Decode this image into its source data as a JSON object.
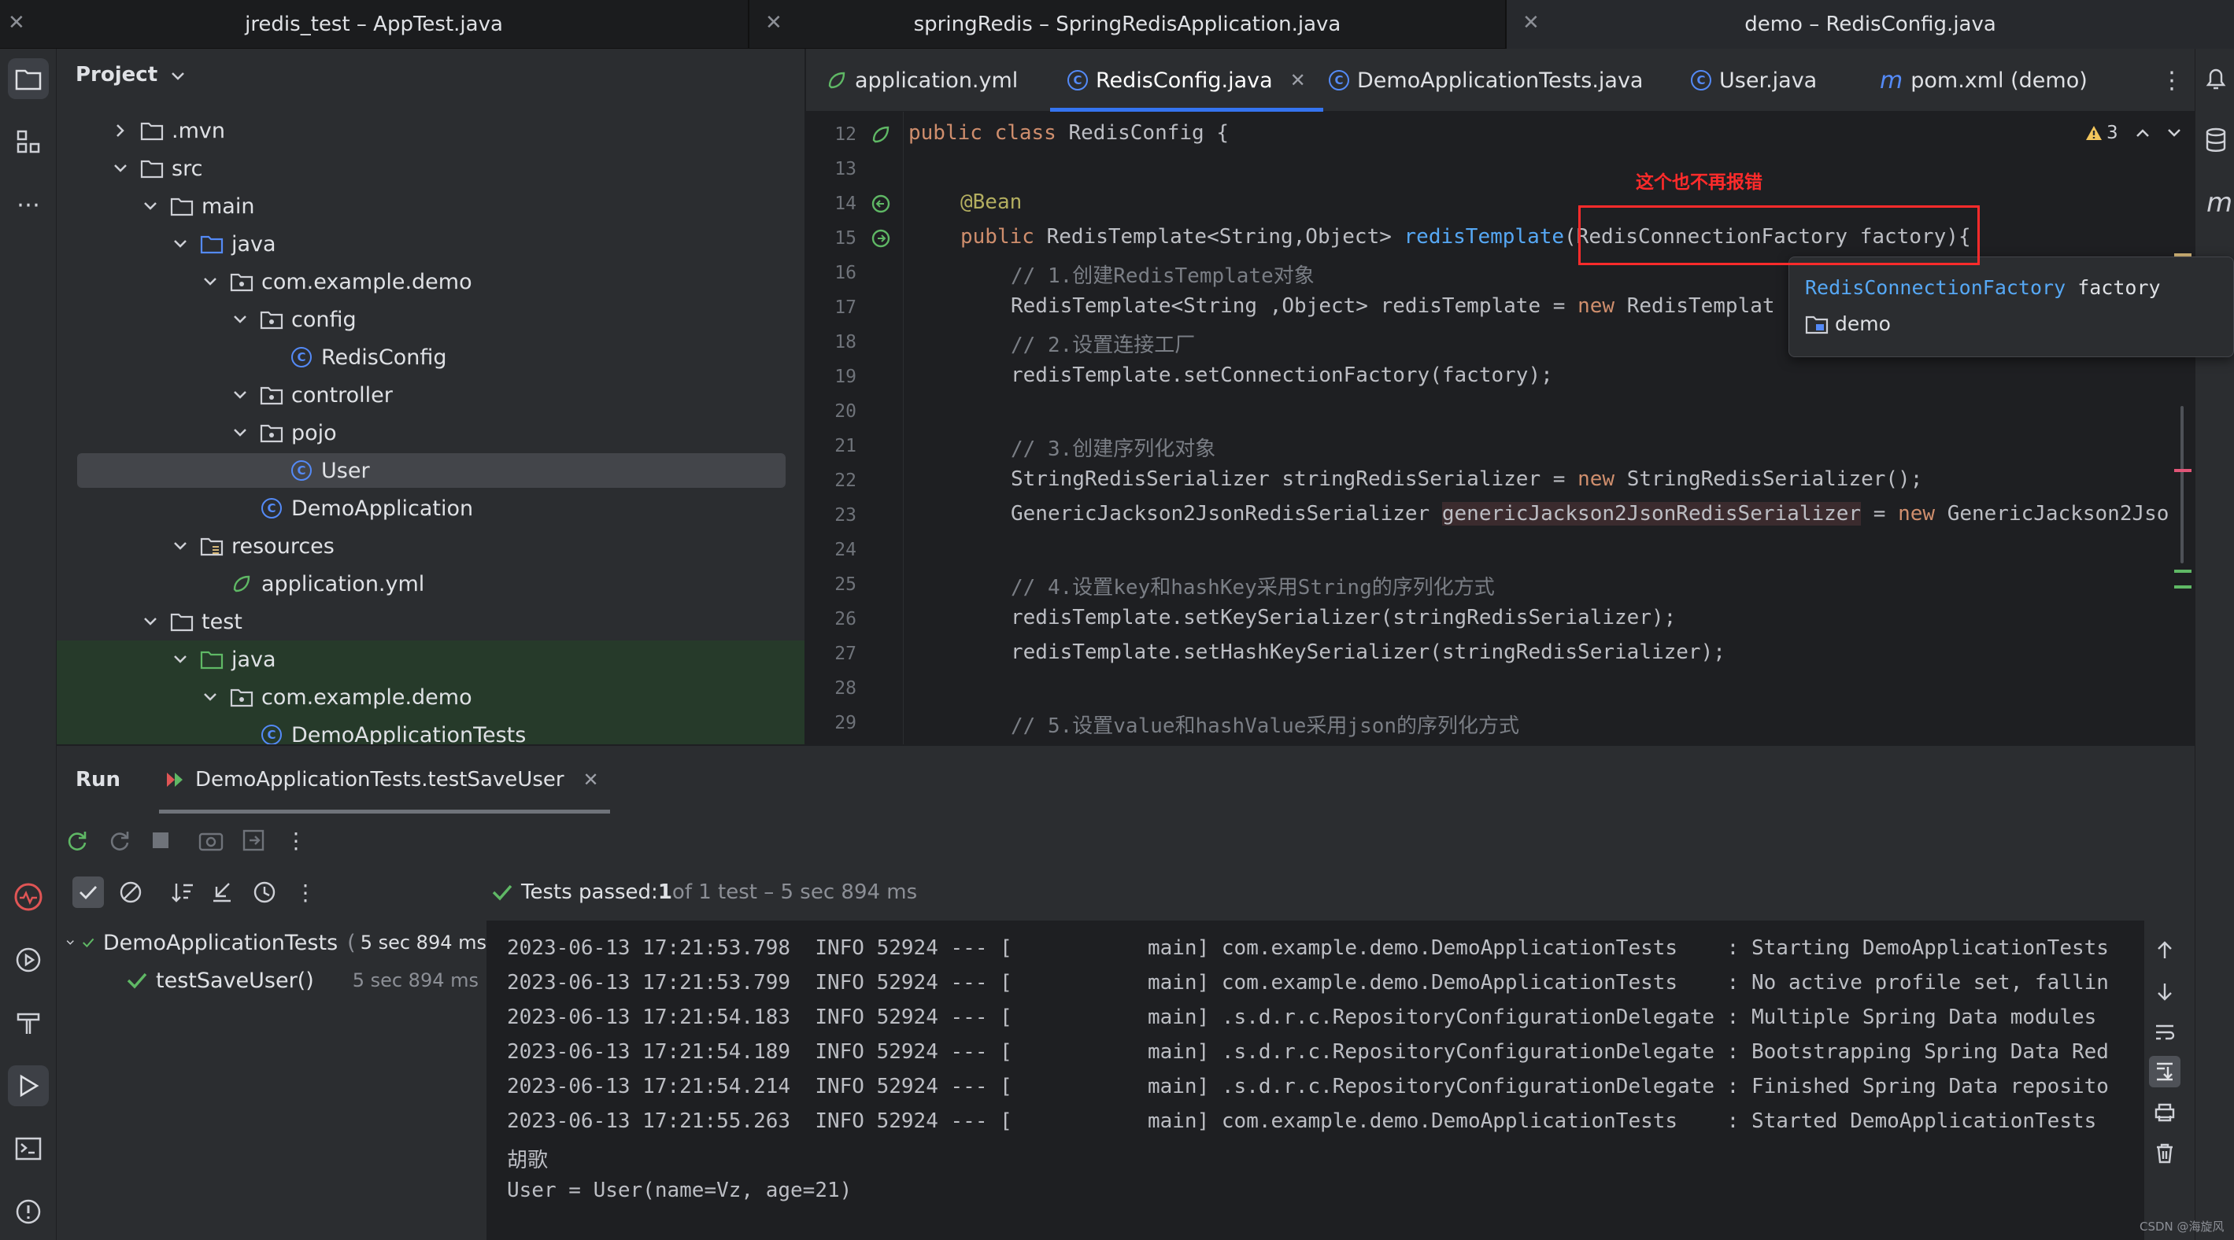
{
  "window_tabs": [
    {
      "title": "jredis_test – AppTest.java"
    },
    {
      "title": "springRedis – SpringRedisApplication.java"
    },
    {
      "title": "demo – RedisConfig.java"
    }
  ],
  "project": {
    "header": "Project",
    "tree": [
      {
        "label": ".mvn"
      },
      {
        "label": "src"
      },
      {
        "label": "main"
      },
      {
        "label": "java"
      },
      {
        "label": "com.example.demo"
      },
      {
        "label": "config"
      },
      {
        "label": "RedisConfig"
      },
      {
        "label": "controller"
      },
      {
        "label": "pojo"
      },
      {
        "label": "User"
      },
      {
        "label": "DemoApplication"
      },
      {
        "label": "resources"
      },
      {
        "label": "application.yml"
      },
      {
        "label": "test"
      },
      {
        "label": "java"
      },
      {
        "label": "com.example.demo"
      },
      {
        "label": "DemoApplicationTests"
      }
    ]
  },
  "editor": {
    "tabs": [
      {
        "label": "application.yml"
      },
      {
        "label": "RedisConfig.java"
      },
      {
        "label": "DemoApplicationTests.java"
      },
      {
        "label": "User.java"
      },
      {
        "label": "pom.xml (demo)"
      }
    ],
    "warning_count": "3",
    "annotation_note": "这个也不再报错",
    "line_numbers": [
      "12",
      "13",
      "14",
      "15",
      "16",
      "17",
      "18",
      "19",
      "20",
      "21",
      "22",
      "23",
      "24",
      "25",
      "26",
      "27",
      "28",
      "29"
    ],
    "code": {
      "l12_kw": "public class ",
      "l12_rest": "RedisConfig {",
      "l14_ann": "@Bean",
      "l15_kw": "public ",
      "l15_type": "RedisTemplate<String,Object> ",
      "l15_fn": "redisTemplate",
      "l15_params": "(RedisConnectionFactory factory)",
      "l15_end": "{",
      "l16": "// 1.创建RedisTemplate对象",
      "l17_a": "RedisTemplate<String ,Object> redisTemplate = ",
      "l17_kw": "new ",
      "l17_b": "RedisTemplat",
      "l18": "// 2.设置连接工厂",
      "l19": "redisTemplate.setConnectionFactory(factory);",
      "l21": "// 3.创建序列化对象",
      "l22_a": "StringRedisSerializer stringRedisSerializer = ",
      "l22_kw": "new ",
      "l22_b": "StringRedisSerializer();",
      "l23_a": "GenericJackson2JsonRedisSerializer ",
      "l23_var": "genericJackson2JsonRedisSerializer",
      "l23_b": " = ",
      "l23_kw": "new ",
      "l23_c": "GenericJackson2Jso",
      "l25": "// 4.设置key和hashKey采用String的序列化方式",
      "l26": "redisTemplate.setKeySerializer(stringRedisSerializer);",
      "l27": "redisTemplate.setHashKeySerializer(stringRedisSerializer);",
      "l29": "// 5.设置value和hashValue采用json的序列化方式"
    },
    "popup": {
      "type": "RedisConnectionFactory",
      "name": " factory",
      "module": "demo"
    }
  },
  "run": {
    "tab_run": "Run",
    "tab_config": "DemoApplicationTests.testSaveUser",
    "status_prefix": "Tests passed: ",
    "status_count": "1",
    "status_rest": " of 1 test – 5 sec 894 ms",
    "tests": [
      {
        "name": "DemoApplicationTests",
        "time": "5 sec 894 ms"
      },
      {
        "name": "testSaveUser()",
        "time": "5 sec 894 ms"
      }
    ],
    "log": [
      "2023-06-13 17:21:53.798  INFO 52924 --- [           main] com.example.demo.DemoApplicationTests    : Starting DemoApplicationTests",
      "2023-06-13 17:21:53.799  INFO 52924 --- [           main] com.example.demo.DemoApplicationTests    : No active profile set, fallin",
      "2023-06-13 17:21:54.183  INFO 52924 --- [           main] .s.d.r.c.RepositoryConfigurationDelegate : Multiple Spring Data modules",
      "2023-06-13 17:21:54.189  INFO 52924 --- [           main] .s.d.r.c.RepositoryConfigurationDelegate : Bootstrapping Spring Data Red",
      "2023-06-13 17:21:54.214  INFO 52924 --- [           main] .s.d.r.c.RepositoryConfigurationDelegate : Finished Spring Data reposito",
      "2023-06-13 17:21:55.263  INFO 52924 --- [           main] com.example.demo.DemoApplicationTests    : Started DemoApplicationTests",
      "胡歌",
      "User = User(name=Vz, age=21)"
    ]
  },
  "watermark": "CSDN @海旋风",
  "colors": {
    "accent": "#3574f0",
    "success": "#5fb865",
    "annotation_red": "#ff2b2b"
  }
}
